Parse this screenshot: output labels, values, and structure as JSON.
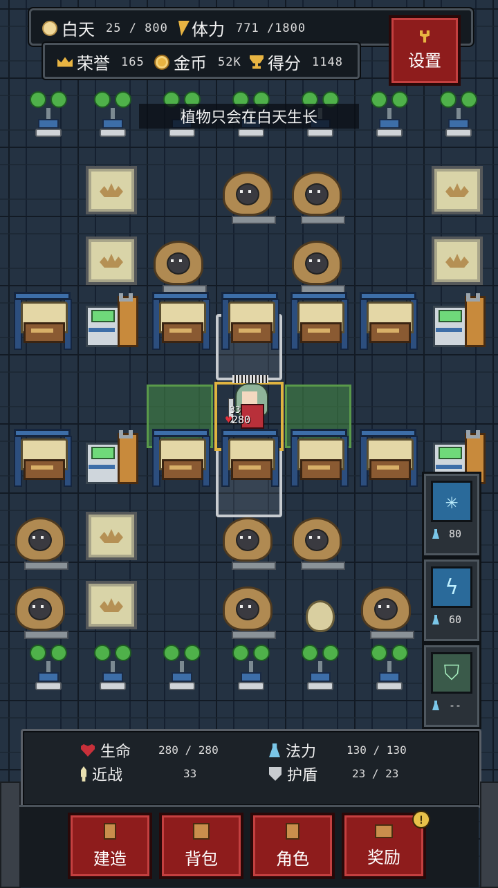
{
  "hud": {
    "day_label": "白天",
    "day_value": "25 / 800",
    "stamina_label": "体力",
    "stamina_value": "771 /1800",
    "honor_label": "荣誉",
    "honor_value": "165",
    "gold_label": "金币",
    "gold_value": "52K",
    "score_label": "得分",
    "score_value": "1148"
  },
  "settings_label": "设置",
  "banner_text": "植物只会在白天生长",
  "hero": {
    "attack": "33",
    "hp": "280"
  },
  "skills": [
    {
      "name": "frost-rune",
      "cost": "80",
      "color": "#6ec8f0"
    },
    {
      "name": "lightning-rune",
      "cost": "60",
      "color": "#6ec8f0"
    },
    {
      "name": "shield-rune",
      "cost": "--",
      "color": "#7cd0a0"
    }
  ],
  "stats": {
    "hp_label": "生命",
    "hp_value": "280 / 280",
    "melee_label": "近战",
    "melee_value": "33",
    "mana_label": "法力",
    "mana_value": "130 / 130",
    "shield_label": "护盾",
    "shield_value": "23 / 23"
  },
  "nav": {
    "build": "建造",
    "bag": "背包",
    "character": "角色",
    "reward": "奖励",
    "reward_badge": "!"
  }
}
